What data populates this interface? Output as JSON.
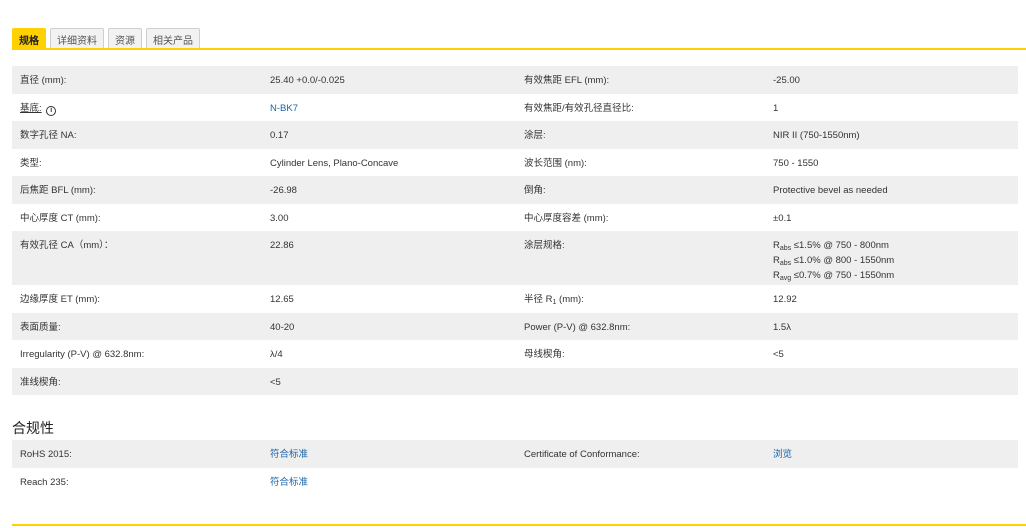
{
  "tabs": [
    {
      "label": "规格",
      "active": true
    },
    {
      "label": "详细资料",
      "active": false
    },
    {
      "label": "资源",
      "active": false
    },
    {
      "label": "相关产品",
      "active": false
    }
  ],
  "specs": {
    "r1": {
      "k1": "直径 (mm):",
      "v1": "25.40 +0.0/-0.025",
      "k2": "有效焦距 EFL (mm):",
      "v2": "-25.00"
    },
    "r2": {
      "k1": "基底:",
      "info": "i",
      "v1": "N-BK7",
      "k2": "有效焦距/有效孔径直径比:",
      "v2": "1"
    },
    "r3": {
      "k1": "数字孔径 NA:",
      "v1": "0.17",
      "k2": "涂层:",
      "v2": "NIR II (750-1550nm)"
    },
    "r4": {
      "k1": "类型:",
      "v1": "Cylinder Lens, Plano-Concave",
      "k2": "波长范围 (nm):",
      "v2": "750 - 1550"
    },
    "r5": {
      "k1": "后焦距 BFL (mm):",
      "v1": "-26.98",
      "k2": "倒角:",
      "v2": "Protective bevel as needed"
    },
    "r6": {
      "k1": "中心厚度 CT (mm):",
      "v1": "3.00",
      "k2": "中心厚度容差 (mm):",
      "v2": "±0.1"
    },
    "r7": {
      "k1": "有效孔径 CA（mm）：",
      "v1": "22.86",
      "k2": "涂层规格:",
      "coating": [
        {
          "r": "R",
          "sub": "abs",
          "text": " ≤1.5% @ 750 - 800nm"
        },
        {
          "r": "R",
          "sub": "abs",
          "text": " ≤1.0% @ 800 - 1550nm"
        },
        {
          "r": "R",
          "sub": "avg",
          "text": " ≤0.7% @ 750 - 1550nm"
        }
      ]
    },
    "r8": {
      "k1": "边缘厚度 ET (mm):",
      "v1": "12.65",
      "k2a": "半径 R",
      "k2sub": "1",
      "k2b": " (mm):",
      "v2": "12.92"
    },
    "r9": {
      "k1": "表面质量:",
      "v1": "40-20",
      "k2": "Power (P-V) @ 632.8nm:",
      "v2": "1.5λ"
    },
    "r10": {
      "k1": "Irregularity (P-V) @ 632.8nm:",
      "v1": "λ/4",
      "k2": "母线楔角:",
      "v2": "<5"
    },
    "r11": {
      "k1": "准线楔角:",
      "v1": "<5"
    }
  },
  "compliance": {
    "title": "合规性",
    "r1": {
      "k1": "RoHS 2015:",
      "v1": "符合标准",
      "k2": "Certificate of Conformance:",
      "v2": "浏览"
    },
    "r2": {
      "k1": "Reach 235:",
      "v1": "符合标准"
    }
  },
  "colors": {
    "accent": "#ffd100",
    "link": "#1a63a6",
    "row_shade": "#efefef"
  }
}
